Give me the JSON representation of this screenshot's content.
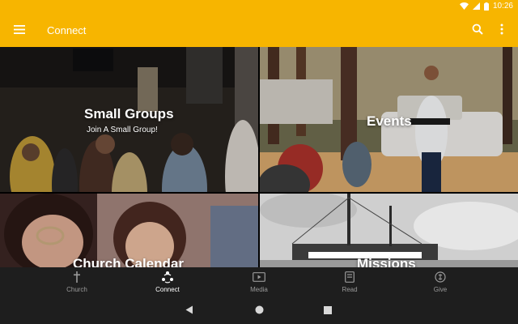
{
  "status_bar": {
    "time": "10:26"
  },
  "app_bar": {
    "title": "Connect"
  },
  "tiles": [
    {
      "title": "Small Groups",
      "subtitle": "Join A Small Group!"
    },
    {
      "title": "Events",
      "subtitle": ""
    },
    {
      "title": "Church Calendar",
      "subtitle": ""
    },
    {
      "title": "Missions",
      "subtitle": ""
    }
  ],
  "bottom_nav": {
    "items": [
      {
        "label": "Church",
        "icon": "cross-icon"
      },
      {
        "label": "Connect",
        "icon": "connect-icon",
        "active": true
      },
      {
        "label": "Media",
        "icon": "play-icon"
      },
      {
        "label": "Read",
        "icon": "book-icon"
      },
      {
        "label": "Give",
        "icon": "give-icon"
      }
    ]
  },
  "colors": {
    "accent": "#f7b500",
    "nav_bg": "#1e1e1e"
  }
}
